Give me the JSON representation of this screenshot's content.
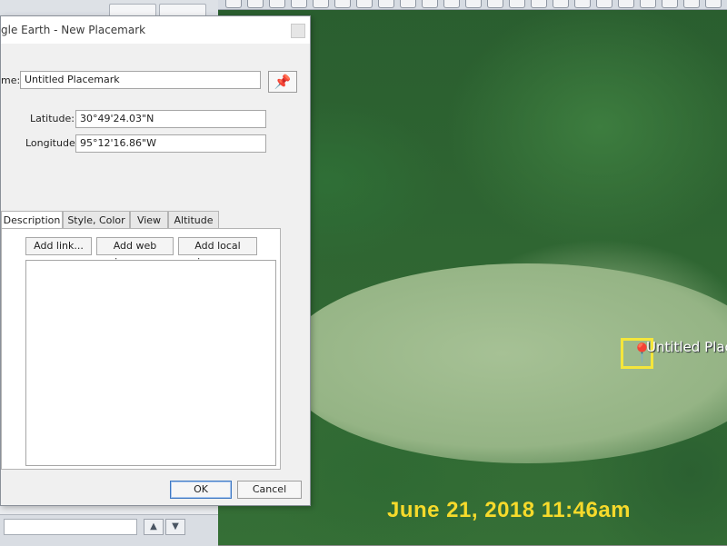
{
  "dialog": {
    "title": "gle Earth - New Placemark",
    "name_label": "me:",
    "name_value": "Untitled Placemark",
    "latitude_label": "Latitude:",
    "latitude_value": "30°49'24.03\"N",
    "longitude_label": "Longitude:",
    "longitude_value": "95°12'16.86\"W",
    "tabs": [
      "Description",
      "Style, Color",
      "View",
      "Altitude"
    ],
    "buttons": {
      "add_link": "Add link...",
      "add_web_image": "Add web image...",
      "add_local_image": "Add local image...",
      "ok": "OK",
      "cancel": "Cancel"
    }
  },
  "sidebar": {
    "ghost_text": "Untitled Placemark",
    "arrows": [
      "▲",
      "▼"
    ]
  },
  "map": {
    "placemark_label": "Untitled Plac",
    "timestamp": "June 21, 2018 11:46am"
  },
  "colors": {
    "pin": "#f7e53c",
    "timestamp": "#f6da2b",
    "dialog_bg": "#f0f0f0"
  }
}
